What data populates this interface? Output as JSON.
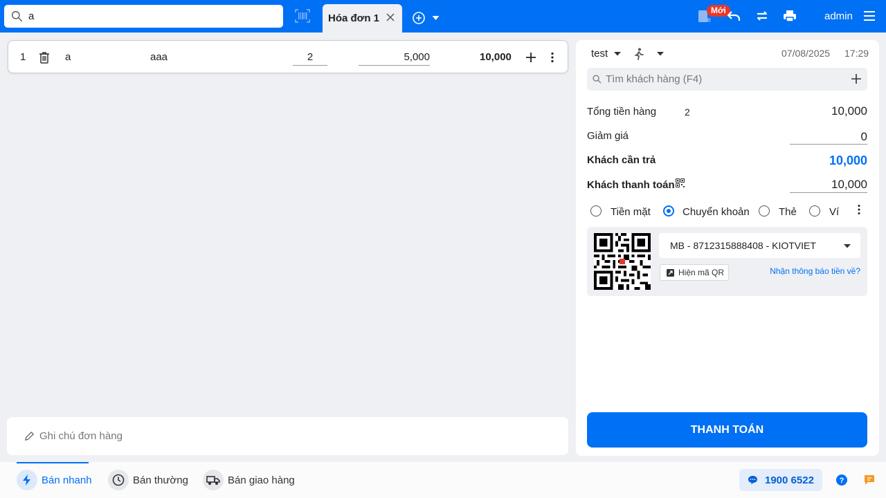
{
  "header": {
    "search_value": "a",
    "tab_label": "Hóa đơn 1",
    "new_badge": "Mới",
    "user": "admin"
  },
  "cart": {
    "items": [
      {
        "index": "1",
        "code": "a",
        "name": "aaa",
        "quantity": "2",
        "price": "5,000",
        "total": "10,000"
      }
    ],
    "note_placeholder": "Ghi chú đơn hàng"
  },
  "order": {
    "seller": "test",
    "date": "07/08/2025",
    "time": "17:29",
    "customer_search_placeholder": "Tìm khách hàng (F4)",
    "summary": {
      "subtotal_label": "Tổng tiền hàng",
      "item_count": "2",
      "subtotal": "10,000",
      "discount_label": "Giảm giá",
      "discount": "0",
      "due_label": "Khách cần trả",
      "due": "10,000",
      "paid_label": "Khách thanh toán",
      "paid": "10,000"
    },
    "payment_methods": [
      "Tiền mặt",
      "Chuyển khoản",
      "Thẻ",
      "Ví"
    ],
    "selected_method": "Chuyển khoản",
    "bank_account": "MB - 8712315888408 - KIOTVIET",
    "show_qr_label": "Hiện mã QR",
    "notify_link": "Nhận thông báo tiền về?",
    "pay_button": "THANH TOÁN"
  },
  "bottom": {
    "modes": [
      "Bán nhanh",
      "Bán thường",
      "Bán giao hàng"
    ],
    "active_mode": "Bán nhanh",
    "hotline": "1900 6522"
  },
  "colors": {
    "brand": "#0070f4",
    "background": "#eef0f4",
    "badge": "#e8382b"
  }
}
